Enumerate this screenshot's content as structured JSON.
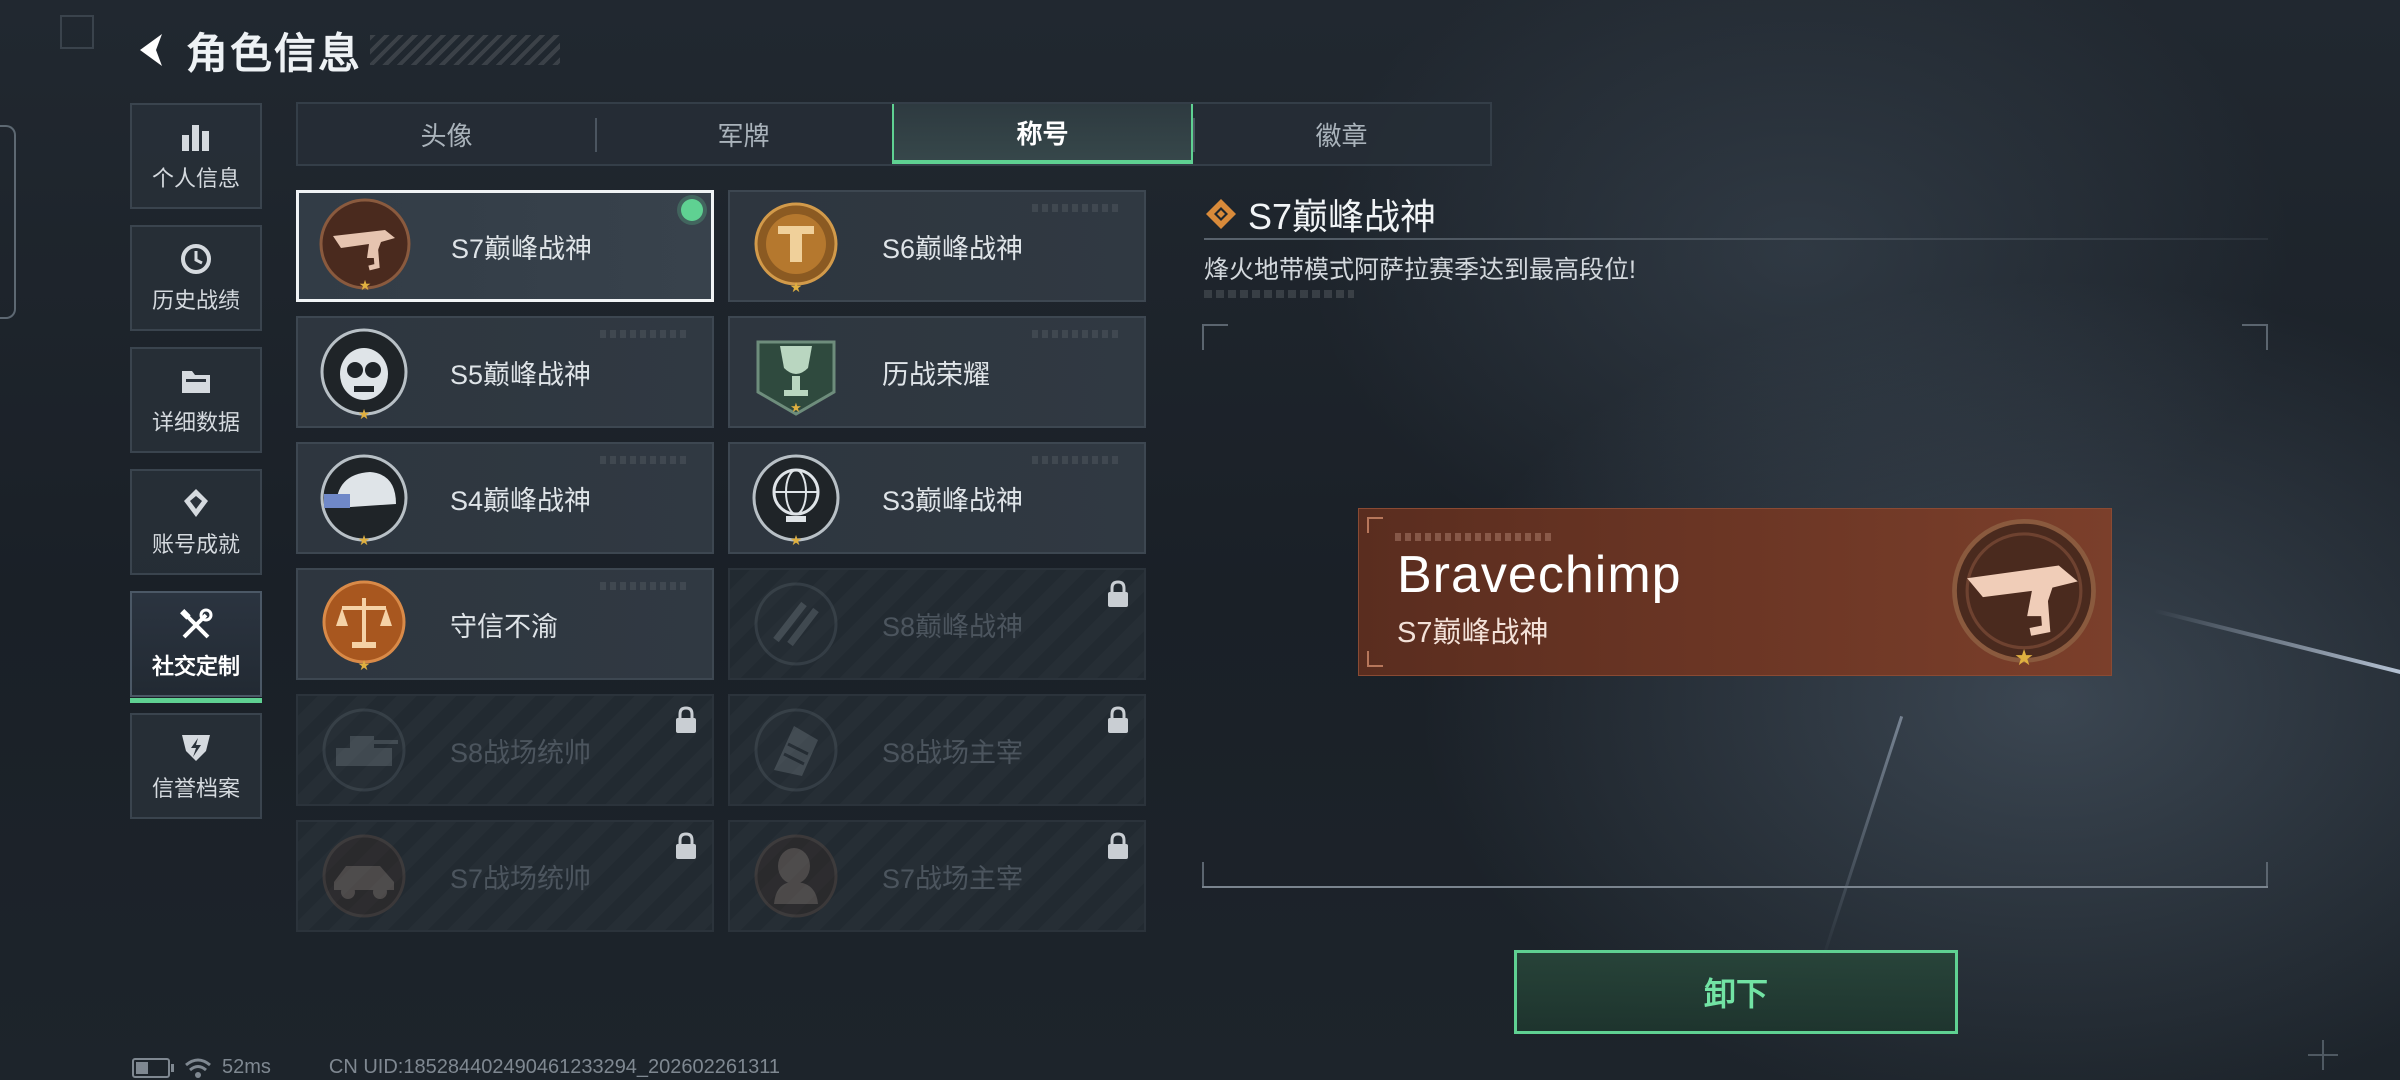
{
  "header": {
    "title": "角色信息",
    "back_icon": "back-arrow-icon"
  },
  "nav": {
    "items": [
      {
        "label": "个人信息",
        "icon": "bar-chart-icon",
        "active": false
      },
      {
        "label": "历史战绩",
        "icon": "history-icon",
        "active": false
      },
      {
        "label": "详细数据",
        "icon": "folder-icon",
        "active": false
      },
      {
        "label": "账号成就",
        "icon": "achievement-icon",
        "active": false
      },
      {
        "label": "社交定制",
        "icon": "tools-icon",
        "active": true
      },
      {
        "label": "信誉档案",
        "icon": "shield-lightning-icon",
        "active": false
      }
    ]
  },
  "tabs": [
    {
      "label": "头像",
      "active": false
    },
    {
      "label": "军牌",
      "active": false
    },
    {
      "label": "称号",
      "active": true
    },
    {
      "label": "徽章",
      "active": false
    }
  ],
  "titles": [
    {
      "label": "S7巅峰战神",
      "state": "equipped",
      "badge": "bronze-gun-badge"
    },
    {
      "label": "S6巅峰战神",
      "state": "unlocked",
      "badge": "gold-emblem-badge"
    },
    {
      "label": "S5巅峰战神",
      "state": "unlocked",
      "badge": "silver-skull-badge"
    },
    {
      "label": "历战荣耀",
      "state": "unlocked",
      "badge": "green-trophy-badge"
    },
    {
      "label": "S4巅峰战神",
      "state": "unlocked",
      "badge": "silver-helmet-badge"
    },
    {
      "label": "S3巅峰战神",
      "state": "unlocked",
      "badge": "silver-globe-badge"
    },
    {
      "label": "守信不渝",
      "state": "unlocked",
      "badge": "bronze-scales-badge"
    },
    {
      "label": "S8巅峰战神",
      "state": "locked",
      "badge": "dark-slash-badge"
    },
    {
      "label": "S8战场统帅",
      "state": "locked",
      "badge": "dark-tank-badge"
    },
    {
      "label": "S8战场主宰",
      "state": "locked",
      "badge": "dark-building-badge"
    },
    {
      "label": "S7战场统帅",
      "state": "locked",
      "badge": "dark-vehicle-badge"
    },
    {
      "label": "S7战场主宰",
      "state": "locked",
      "badge": "dark-soldier-badge"
    }
  ],
  "detail": {
    "title": "S7巅峰战神",
    "description": "烽火地带模式阿萨拉赛季达到最高段位!",
    "title_icon": "diamond-icon"
  },
  "nameplate": {
    "player_name": "Bravechimp",
    "title": "S7巅峰战神",
    "badge": "bronze-gun-badge"
  },
  "actions": {
    "unequip_label": "卸下"
  },
  "footer": {
    "ping": "52ms",
    "uid": "CN UID:1852844024904612332​94_202602261311"
  },
  "colors": {
    "accent": "#5fd192",
    "nameplate": "#6a3524",
    "background": "#1b2128"
  }
}
